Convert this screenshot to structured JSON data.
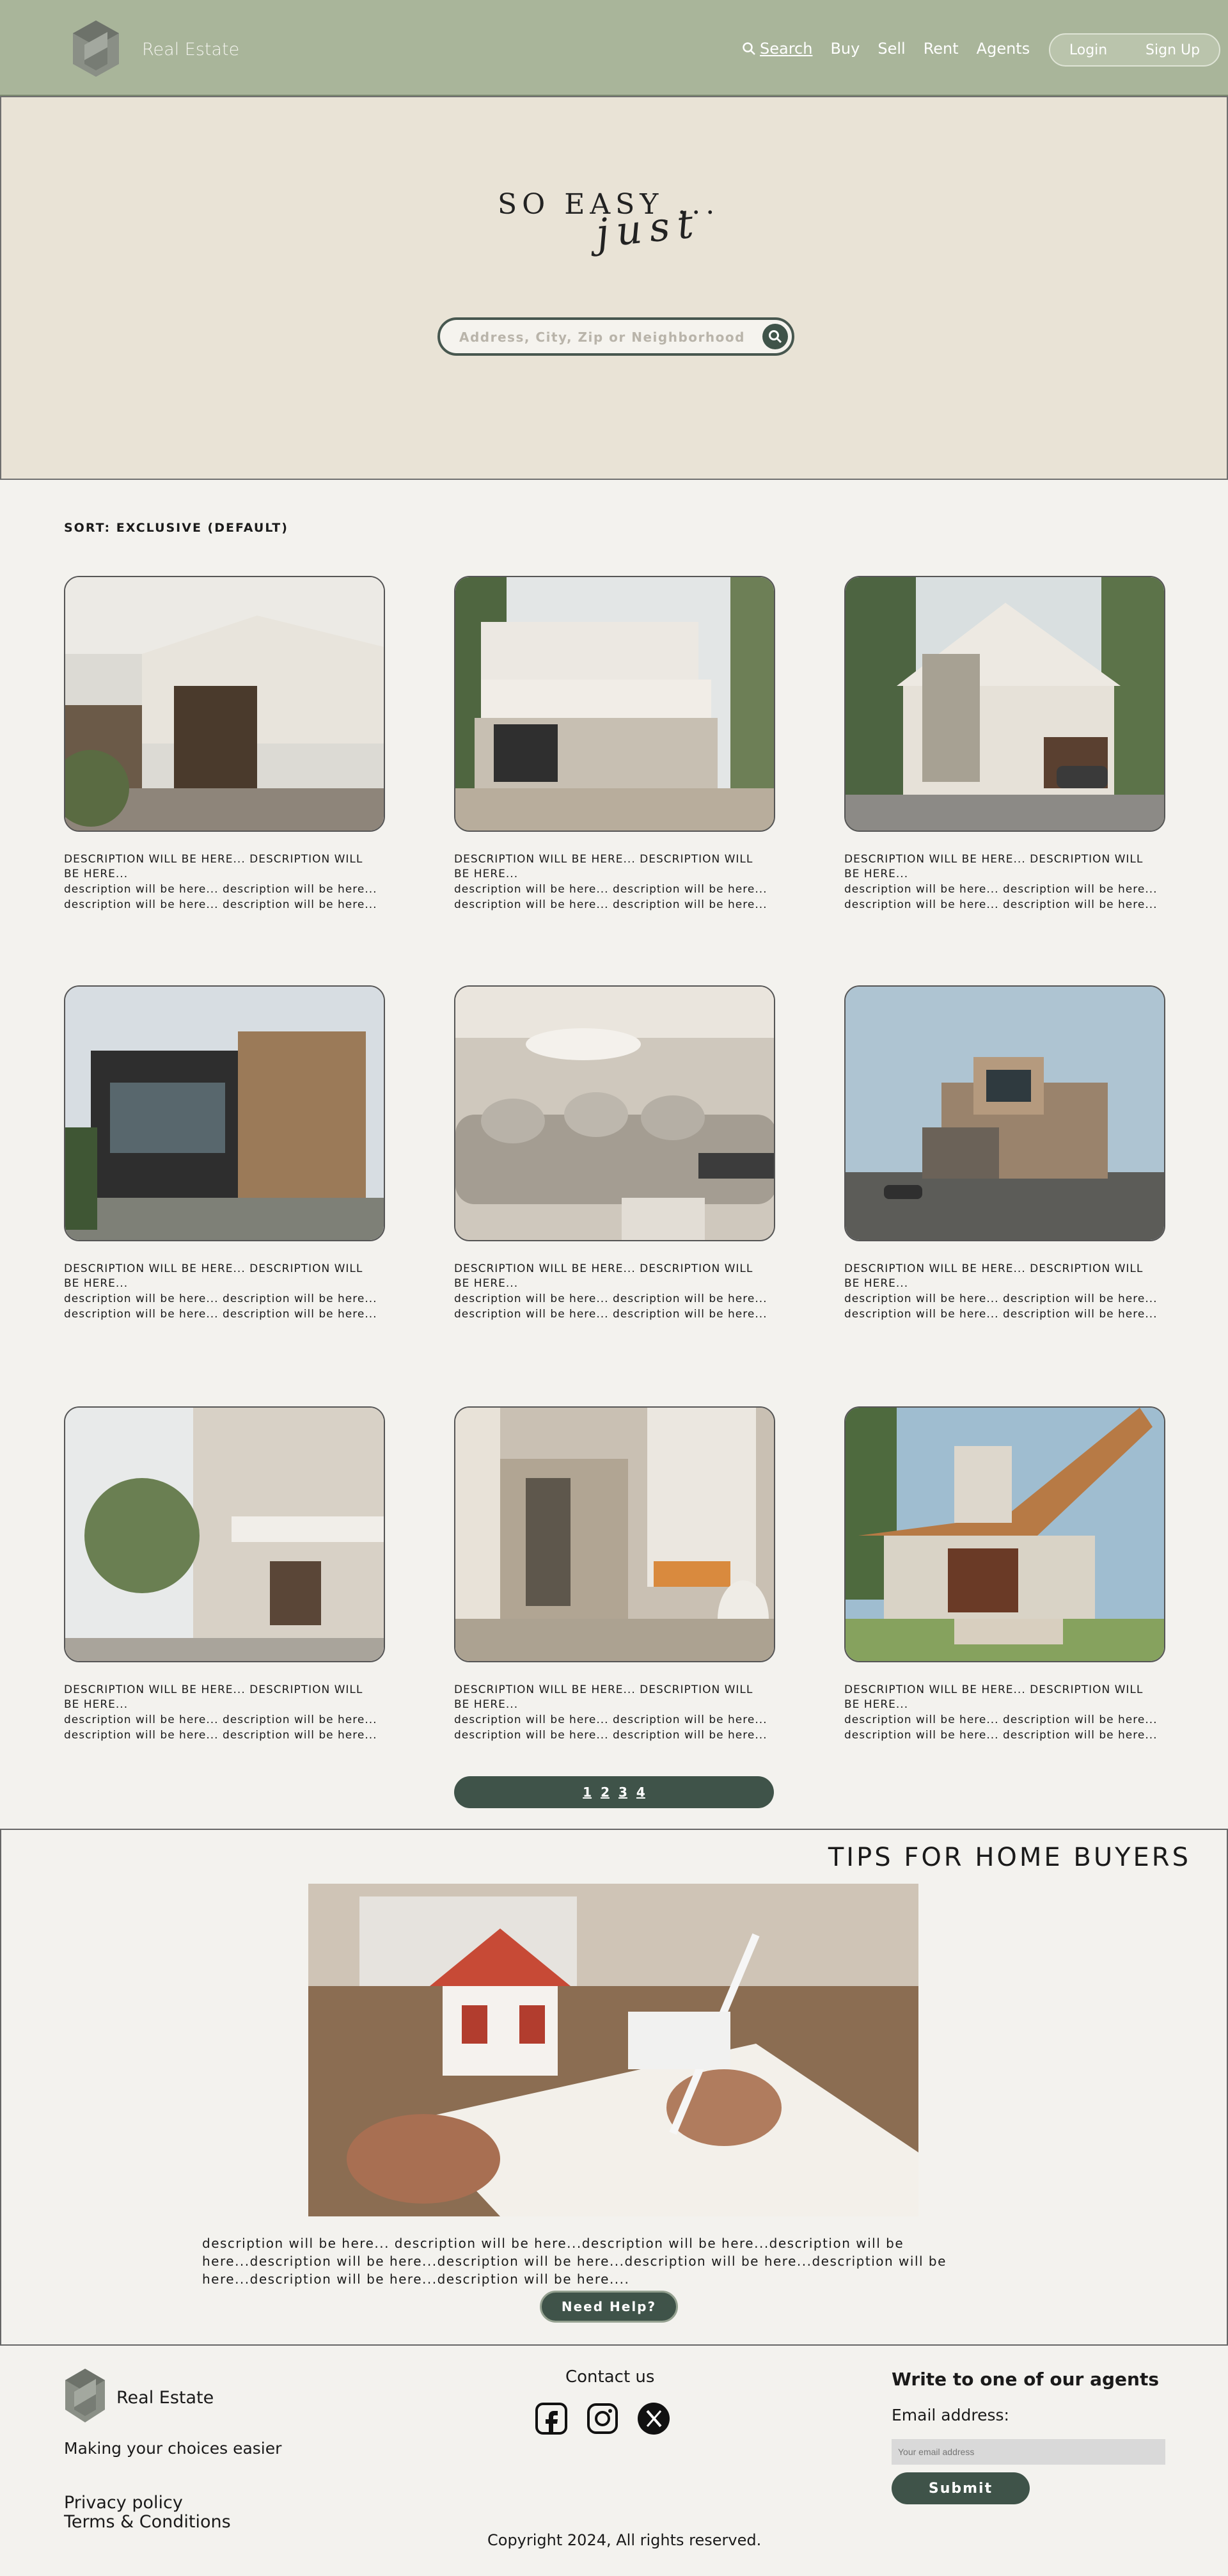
{
  "header": {
    "brand": "Real Estate",
    "nav": {
      "search": "Search",
      "buy": "Buy",
      "sell": "Sell",
      "rent": "Rent",
      "agents": "Agents"
    },
    "login": "Login",
    "signup": "Sign Up"
  },
  "hero": {
    "line1": "SO EASY ...",
    "line2": "just",
    "search_placeholder": "Address, City, Zip or Neighborhood"
  },
  "listings": {
    "sort_label": "SORT: EXCLUSIVE (DEFAULT)",
    "items": [
      {
        "title": "DESCRIPTION WILL BE HERE... DESCRIPTION WILL BE HERE...",
        "desc1": "description will be here... description will be here...",
        "desc2": "description will be here... description will be here..."
      },
      {
        "title": "DESCRIPTION WILL BE HERE... DESCRIPTION WILL BE HERE...",
        "desc1": "description will be here... description will be here...",
        "desc2": "description will be here... description will be here..."
      },
      {
        "title": "DESCRIPTION WILL BE HERE... DESCRIPTION WILL BE HERE...",
        "desc1": "description will be here... description will be here...",
        "desc2": "description will be here... description will be here..."
      },
      {
        "title": "DESCRIPTION WILL BE HERE... DESCRIPTION WILL BE HERE...",
        "desc1": "description will be here... description will be here...",
        "desc2": "description will be here... description will be here..."
      },
      {
        "title": "DESCRIPTION WILL BE HERE... DESCRIPTION WILL BE HERE...",
        "desc1": "description will be here... description will be here...",
        "desc2": "description will be here... description will be here..."
      },
      {
        "title": "DESCRIPTION WILL BE HERE... DESCRIPTION WILL BE HERE...",
        "desc1": "description will be here... description will be here...",
        "desc2": "description will be here... description will be here..."
      },
      {
        "title": "DESCRIPTION WILL BE HERE... DESCRIPTION WILL BE HERE...",
        "desc1": "description will be here... description will be here...",
        "desc2": "description will be here... description will be here..."
      },
      {
        "title": "DESCRIPTION WILL BE HERE... DESCRIPTION WILL BE HERE...",
        "desc1": "description will be here... description will be here...",
        "desc2": "description will be here... description will be here..."
      },
      {
        "title": "DESCRIPTION WILL BE HERE... DESCRIPTION WILL BE HERE...",
        "desc1": "description will be here... description will be here...",
        "desc2": "description will be here... description will be here..."
      }
    ],
    "pages": [
      "1",
      "2",
      "3",
      "4"
    ]
  },
  "tips": {
    "title": "TIPS FOR HOME BUYERS",
    "text": "description will be here... description will be here...description will be here...description will be here...description will be here...description will be here...description will be here...description will be here...description will be here...description will be here....",
    "help_button": "Need Help?"
  },
  "footer": {
    "brand": "Real Estate",
    "tagline": "Making your choices easier",
    "privacy": "Privacy policy",
    "terms": "Terms & Conditions",
    "contact_title": "Contact us",
    "copyright": "Copyright 2024, All rights reserved.",
    "write_title": "Write to one of our agents",
    "email_label": "Email address:",
    "email_placeholder": "Your email address",
    "submit": "Submit"
  },
  "icons": {
    "logo": "hexagon-logo-icon",
    "search": "search-icon",
    "facebook": "facebook-icon",
    "instagram": "instagram-icon",
    "x": "x-icon"
  },
  "colors": {
    "header_bg": "#a9b59a",
    "hero_bg": "#e9e3d6",
    "accent_dark": "#3f5349",
    "page_bg": "#f3f2ee"
  }
}
